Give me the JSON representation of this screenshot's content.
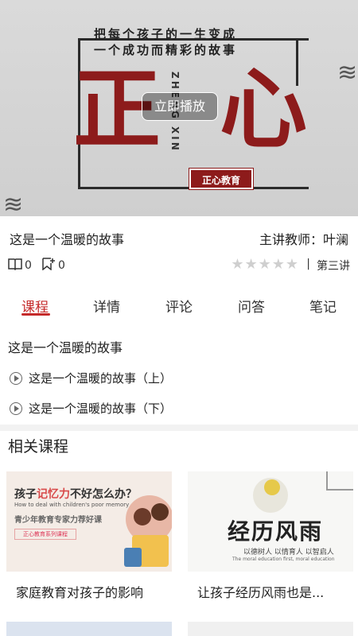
{
  "banner": {
    "motto_line1": "把每个孩子的一生变成",
    "motto_line2": "一个成功而精彩的故事",
    "char1": "正",
    "char2": "心",
    "pinyin": "ZHENG XIN",
    "stamp": "正心教育",
    "play_label": "立即播放"
  },
  "lesson": {
    "title": "这是一个温暖的故事",
    "teacher": "主讲教师：叶澜",
    "views": "0",
    "favorites": "0",
    "stars": "★★★★★",
    "rating": 0,
    "separator": "|",
    "lecture_no": "第三讲"
  },
  "tabs": [
    {
      "label": "课程"
    },
    {
      "label": "详情"
    },
    {
      "label": "评论"
    },
    {
      "label": "问答"
    },
    {
      "label": "笔记"
    }
  ],
  "course": {
    "heading": "这是一个温暖的故事",
    "chapters": [
      {
        "label": "这是一个温暖的故事（上）"
      },
      {
        "label": "这是一个温暖的故事（下）"
      }
    ]
  },
  "related": {
    "title": "相关课程",
    "cards": [
      {
        "caption": "家庭教育对孩子的影响",
        "thumb_line1_a": "孩子",
        "thumb_line1_b": "记忆力",
        "thumb_line1_c": "不好怎么办？",
        "thumb_line2": "How to deal with children's poor memory",
        "thumb_line3": "青少年教育专家力荐好课",
        "thumb_tag": "正心教育系列课程"
      },
      {
        "caption": "让孩子经历风雨也是...",
        "thumb_title": "经历风雨",
        "thumb_sub1": "以德树人  以情育人  以智启人",
        "thumb_sub2": "The moral education first, moral education"
      }
    ]
  },
  "colors": {
    "accent": "#c52a2a",
    "seal_red": "#8d1b1b",
    "star_inactive": "#cfcfcf"
  }
}
